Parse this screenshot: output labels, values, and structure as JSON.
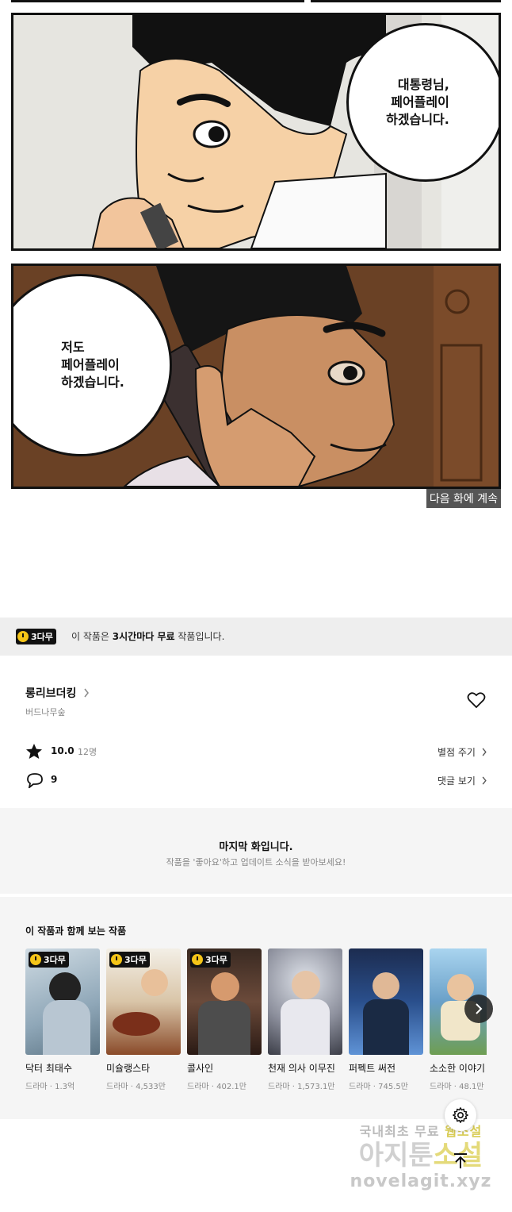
{
  "comic": {
    "bubble1": "대통령님,\n페어플레이\n하겠습니다.",
    "bubble2": "저도\n페어플레이\n하겠습니다.",
    "caption": "다음 화에 계속"
  },
  "free_notice": {
    "badge": "3다무",
    "prefix": "이 작품은 ",
    "bold": "3시간마다 무료",
    "suffix": " 작품입니다."
  },
  "work": {
    "title": "롱리브더킹",
    "author": "버드나무숲",
    "rating": "10.0",
    "rating_count": "12명",
    "rate_link": "별점 주기",
    "comments": "9",
    "comments_link": "댓글 보기"
  },
  "last_episode": {
    "title": "마지막 화입니다.",
    "subtitle": "작품을 '좋아요'하고 업데이트 소식을 받아보세요!"
  },
  "recommend": {
    "heading": "이 작품과 함께 보는 작품",
    "items": [
      {
        "title": "닥터 최태수",
        "meta": "드라마 · 1.3억",
        "badge": "3다무",
        "color": "#8fa7b8"
      },
      {
        "title": "미슐랭스타",
        "meta": "드라마 · 4,533만",
        "badge": "3다무",
        "color": "#c9a27a"
      },
      {
        "title": "콜사인",
        "meta": "드라마 · 402.1만",
        "badge": "3다무",
        "color": "#6b4a3a"
      },
      {
        "title": "천재 의사 이무진",
        "meta": "드라마 · 1,573.1만",
        "badge": "",
        "color": "#8c8f9c"
      },
      {
        "title": "퍼펙트 써전",
        "meta": "드라마 · 745.5만",
        "badge": "",
        "color": "#2a4f8c"
      },
      {
        "title": "소소한 이야기",
        "meta": "드라마 · 48.1만",
        "badge": "",
        "color": "#6aa0c8"
      }
    ]
  },
  "watermark": {
    "line1a": "국내최초 무료 ",
    "line1b": "웹소설",
    "line2a": "아지툰",
    "line2b": "소설",
    "line3": "novelagit.xyz"
  }
}
